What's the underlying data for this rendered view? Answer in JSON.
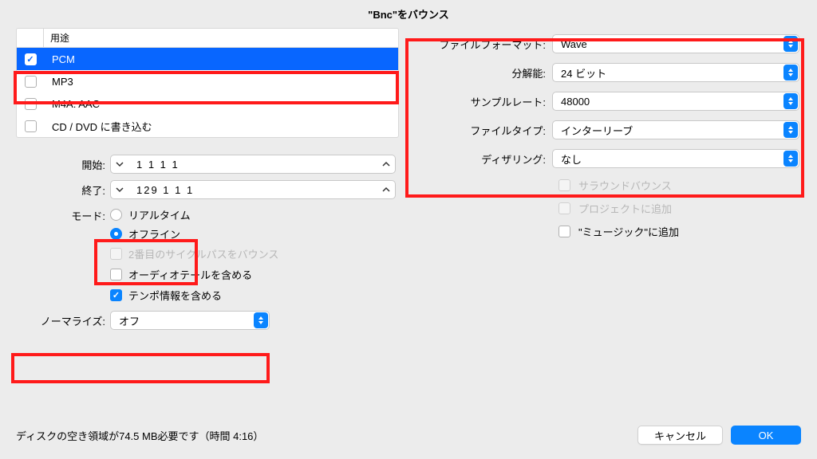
{
  "title": "\"Bnc\"をバウンス",
  "list": {
    "header": "用途",
    "items": [
      {
        "label": "PCM",
        "checked": true,
        "selected": true
      },
      {
        "label": "MP3",
        "checked": false
      },
      {
        "label": "M4A: AAC",
        "checked": false
      },
      {
        "label": "CD / DVD に書き込む",
        "checked": false
      }
    ]
  },
  "start": {
    "label": "開始:",
    "value": "1 1 1    1"
  },
  "end": {
    "label": "終了:",
    "value": "129 1 1    1"
  },
  "mode": {
    "label": "モード:",
    "options": {
      "realtime": "リアルタイム",
      "offline": "オフライン"
    },
    "selected": "offline"
  },
  "checks": {
    "second_cycle": {
      "label": "2番目のサイクルパスをバウンス",
      "checked": false,
      "disabled": true
    },
    "audio_tail": {
      "label": "オーディオテールを含める",
      "checked": false
    },
    "tempo": {
      "label": "テンポ情報を含める",
      "checked": true
    }
  },
  "normalize": {
    "label": "ノーマライズ:",
    "value": "オフ"
  },
  "right": {
    "format": {
      "label": "ファイルフォーマット:",
      "value": "Wave"
    },
    "resolution": {
      "label": "分解能:",
      "value": "24 ビット"
    },
    "sample_rate": {
      "label": "サンプルレート:",
      "value": "48000"
    },
    "file_type": {
      "label": "ファイルタイプ:",
      "value": "インターリーブ"
    },
    "dithering": {
      "label": "ディザリング:",
      "value": "なし"
    },
    "surround": {
      "label": "サラウンドバウンス",
      "disabled": true
    },
    "add_project": {
      "label": "プロジェクトに追加",
      "disabled": true
    },
    "add_music": {
      "label": "\"ミュージック\"に追加"
    }
  },
  "footer": {
    "disk": "ディスクの空き領域が74.5 MB必要です（時間 4:16）",
    "cancel": "キャンセル",
    "ok": "OK"
  }
}
